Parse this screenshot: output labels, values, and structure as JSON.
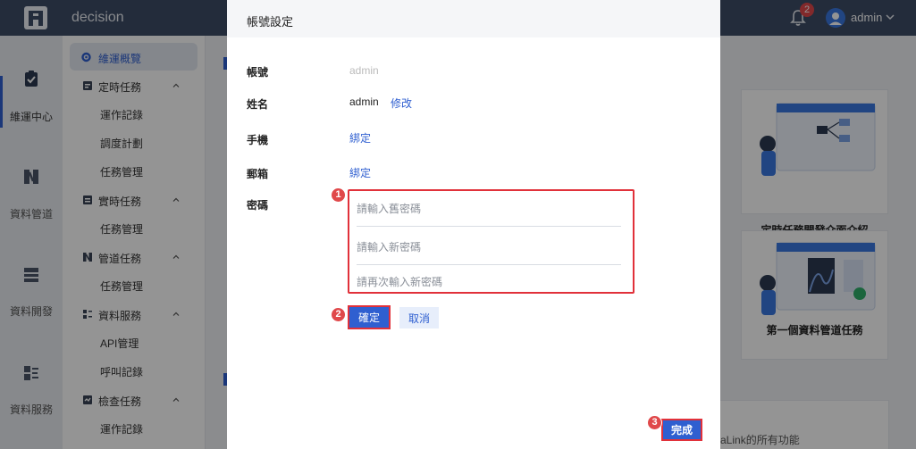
{
  "header": {
    "app_name": "decision",
    "notification_count": "2",
    "user_name": "admin",
    "icons": [
      "logo-icon",
      "bell-icon",
      "user-avatar-icon",
      "chevron-down-icon"
    ]
  },
  "rail": {
    "items": [
      {
        "label": "維運中心",
        "icon": "clipboard-check-icon",
        "active": true
      },
      {
        "label": "資料管道",
        "icon": "pipeline-icon"
      },
      {
        "label": "資料開發",
        "icon": "server-icon"
      },
      {
        "label": "資料服務",
        "icon": "service-icon"
      }
    ]
  },
  "sidebar": {
    "active": {
      "label": "維運概覽",
      "icon": "gear-icon"
    },
    "groups": [
      {
        "label": "定時任務",
        "icon": "calendar-task-icon",
        "children": [
          "運作記錄",
          "調度計劃",
          "任務管理"
        ]
      },
      {
        "label": "實時任務",
        "icon": "realtime-task-icon",
        "children": [
          "任務管理"
        ]
      },
      {
        "label": "管道任務",
        "icon": "pipeline-task-icon",
        "children": [
          "任務管理"
        ]
      },
      {
        "label": "資料服務",
        "icon": "service-task-icon",
        "children": [
          "API管理",
          "呼叫記錄"
        ]
      },
      {
        "label": "檢查任務",
        "icon": "check-task-icon",
        "children": [
          "運作記錄"
        ]
      }
    ]
  },
  "main": {
    "cards": [
      {
        "title": "定時任務開發介面介紹"
      },
      {
        "title": "第一個資料管道任務"
      }
    ],
    "bottom_text": "aLink的所有功能"
  },
  "modal": {
    "title": "帳號設定",
    "fields": {
      "account_label": "帳號",
      "account_value": "admin",
      "name_label": "姓名",
      "name_value": "admin",
      "name_edit": "修改",
      "phone_label": "手機",
      "phone_bind": "綁定",
      "email_label": "郵箱",
      "email_bind": "綁定",
      "password_label": "密碼"
    },
    "password": {
      "old_placeholder": "請輸入舊密碼",
      "new_placeholder": "請輸入新密碼",
      "confirm_placeholder": "請再次輸入新密碼"
    },
    "buttons": {
      "confirm": "確定",
      "cancel": "取消",
      "done": "完成"
    },
    "steps": [
      "1",
      "2",
      "3"
    ]
  },
  "colors": {
    "topbar": "#3d4d66",
    "accent": "#2f5fd0",
    "highlight": "#e1313a"
  }
}
